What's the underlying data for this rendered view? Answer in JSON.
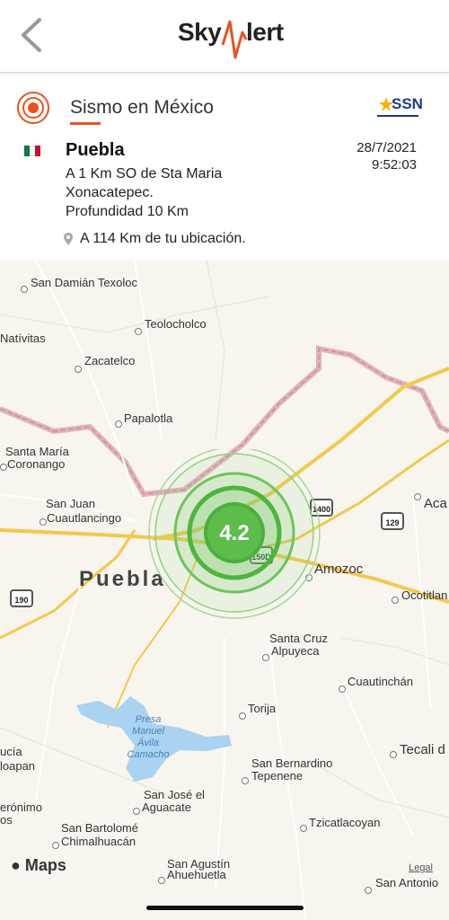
{
  "header": {
    "logo_left": "Sky",
    "logo_right": "lert",
    "back_icon": "chevron-left-icon"
  },
  "event": {
    "title": "Sismo en México",
    "agency_logo": "SSN",
    "region": "Puebla",
    "description_lines": [
      "A 1 Km SO de Sta Maria",
      "Xonacatepec.",
      "Profundidad 10 Km"
    ],
    "date": "28/7/2021",
    "time": "9:52:03",
    "distance": "A 114 Km de tu ubicación.",
    "magnitude": "4.2"
  },
  "map": {
    "city_label": "Puebla",
    "places": [
      "San Damián Texoloc",
      "Teolocholco",
      "Natívitas",
      "Zacatelco",
      "Papalotla",
      "Santa María",
      "Coronango",
      "San Juan",
      "Cuautlancingo",
      "Amozoc",
      "Aca",
      "Ocotitlan",
      "Santa Cruz",
      "Alpuyeca",
      "Cuautinchán",
      "Torija",
      "San Bernardino",
      "Tepenene",
      "Tecali d",
      "San José el",
      "Aguacate",
      "Tzicatlacoyan",
      "San Bartolomé",
      "Chimalhuacán",
      "San Agustín",
      "Ahuehuetla",
      "San Antonio",
      "ucía",
      "loapan",
      "erónimo",
      "os"
    ],
    "lake_lines": [
      "Presa",
      "Manuel",
      "Ávila",
      "Camacho"
    ],
    "shields": [
      "1400",
      "129",
      "150D",
      "190"
    ],
    "attribution": "Maps",
    "legal": "Legal"
  }
}
